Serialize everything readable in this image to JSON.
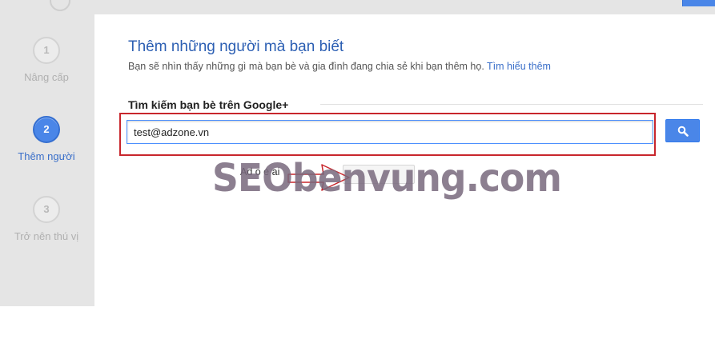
{
  "steps": [
    {
      "number": "1",
      "label": "Nâng cấp",
      "state": "done"
    },
    {
      "number": "2",
      "label": "Thêm người",
      "state": "active"
    },
    {
      "number": "3",
      "label": "Trở nên thú vị",
      "state": "upcoming"
    }
  ],
  "main": {
    "title": "Thêm những người mà bạn biết",
    "subtitle": "Bạn sẽ nhìn thấy những gì mà bạn bè và gia đình đang chia sẻ khi bạn thêm họ.",
    "learn_more": "Tìm hiểu thêm",
    "search_heading": "Tìm kiếm bạn bè trên Google+",
    "search_value": "test@adzone.vn",
    "search_icon": "search-icon",
    "hidden_row_text": "Ad  o  e  ai"
  },
  "watermark": {
    "text": "SEObenvung.com"
  },
  "colors": {
    "accent": "#4a86e8",
    "highlight": "#c8262c",
    "title": "#2c5fb3"
  }
}
